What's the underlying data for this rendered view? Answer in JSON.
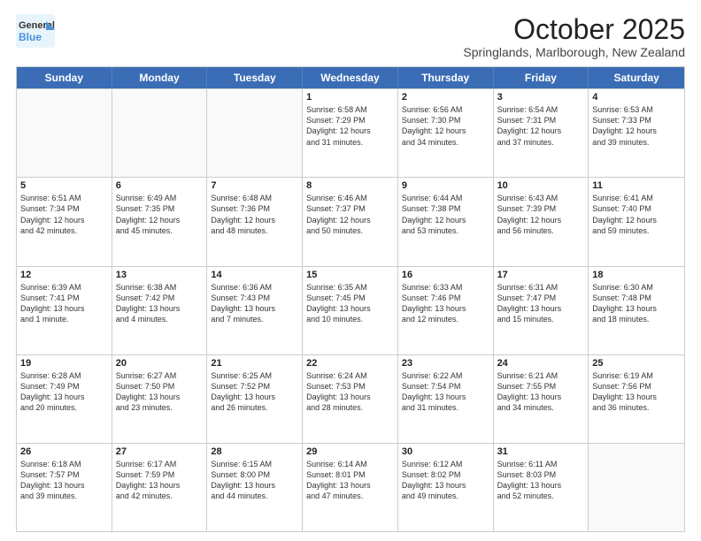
{
  "logo": {
    "line1": "General",
    "line2": "Blue"
  },
  "title": "October 2025",
  "subtitle": "Springlands, Marlborough, New Zealand",
  "header_days": [
    "Sunday",
    "Monday",
    "Tuesday",
    "Wednesday",
    "Thursday",
    "Friday",
    "Saturday"
  ],
  "rows": [
    [
      {
        "day": "",
        "text": ""
      },
      {
        "day": "",
        "text": ""
      },
      {
        "day": "",
        "text": ""
      },
      {
        "day": "1",
        "text": "Sunrise: 6:58 AM\nSunset: 7:29 PM\nDaylight: 12 hours\nand 31 minutes."
      },
      {
        "day": "2",
        "text": "Sunrise: 6:56 AM\nSunset: 7:30 PM\nDaylight: 12 hours\nand 34 minutes."
      },
      {
        "day": "3",
        "text": "Sunrise: 6:54 AM\nSunset: 7:31 PM\nDaylight: 12 hours\nand 37 minutes."
      },
      {
        "day": "4",
        "text": "Sunrise: 6:53 AM\nSunset: 7:33 PM\nDaylight: 12 hours\nand 39 minutes."
      }
    ],
    [
      {
        "day": "5",
        "text": "Sunrise: 6:51 AM\nSunset: 7:34 PM\nDaylight: 12 hours\nand 42 minutes."
      },
      {
        "day": "6",
        "text": "Sunrise: 6:49 AM\nSunset: 7:35 PM\nDaylight: 12 hours\nand 45 minutes."
      },
      {
        "day": "7",
        "text": "Sunrise: 6:48 AM\nSunset: 7:36 PM\nDaylight: 12 hours\nand 48 minutes."
      },
      {
        "day": "8",
        "text": "Sunrise: 6:46 AM\nSunset: 7:37 PM\nDaylight: 12 hours\nand 50 minutes."
      },
      {
        "day": "9",
        "text": "Sunrise: 6:44 AM\nSunset: 7:38 PM\nDaylight: 12 hours\nand 53 minutes."
      },
      {
        "day": "10",
        "text": "Sunrise: 6:43 AM\nSunset: 7:39 PM\nDaylight: 12 hours\nand 56 minutes."
      },
      {
        "day": "11",
        "text": "Sunrise: 6:41 AM\nSunset: 7:40 PM\nDaylight: 12 hours\nand 59 minutes."
      }
    ],
    [
      {
        "day": "12",
        "text": "Sunrise: 6:39 AM\nSunset: 7:41 PM\nDaylight: 13 hours\nand 1 minute."
      },
      {
        "day": "13",
        "text": "Sunrise: 6:38 AM\nSunset: 7:42 PM\nDaylight: 13 hours\nand 4 minutes."
      },
      {
        "day": "14",
        "text": "Sunrise: 6:36 AM\nSunset: 7:43 PM\nDaylight: 13 hours\nand 7 minutes."
      },
      {
        "day": "15",
        "text": "Sunrise: 6:35 AM\nSunset: 7:45 PM\nDaylight: 13 hours\nand 10 minutes."
      },
      {
        "day": "16",
        "text": "Sunrise: 6:33 AM\nSunset: 7:46 PM\nDaylight: 13 hours\nand 12 minutes."
      },
      {
        "day": "17",
        "text": "Sunrise: 6:31 AM\nSunset: 7:47 PM\nDaylight: 13 hours\nand 15 minutes."
      },
      {
        "day": "18",
        "text": "Sunrise: 6:30 AM\nSunset: 7:48 PM\nDaylight: 13 hours\nand 18 minutes."
      }
    ],
    [
      {
        "day": "19",
        "text": "Sunrise: 6:28 AM\nSunset: 7:49 PM\nDaylight: 13 hours\nand 20 minutes."
      },
      {
        "day": "20",
        "text": "Sunrise: 6:27 AM\nSunset: 7:50 PM\nDaylight: 13 hours\nand 23 minutes."
      },
      {
        "day": "21",
        "text": "Sunrise: 6:25 AM\nSunset: 7:52 PM\nDaylight: 13 hours\nand 26 minutes."
      },
      {
        "day": "22",
        "text": "Sunrise: 6:24 AM\nSunset: 7:53 PM\nDaylight: 13 hours\nand 28 minutes."
      },
      {
        "day": "23",
        "text": "Sunrise: 6:22 AM\nSunset: 7:54 PM\nDaylight: 13 hours\nand 31 minutes."
      },
      {
        "day": "24",
        "text": "Sunrise: 6:21 AM\nSunset: 7:55 PM\nDaylight: 13 hours\nand 34 minutes."
      },
      {
        "day": "25",
        "text": "Sunrise: 6:19 AM\nSunset: 7:56 PM\nDaylight: 13 hours\nand 36 minutes."
      }
    ],
    [
      {
        "day": "26",
        "text": "Sunrise: 6:18 AM\nSunset: 7:57 PM\nDaylight: 13 hours\nand 39 minutes."
      },
      {
        "day": "27",
        "text": "Sunrise: 6:17 AM\nSunset: 7:59 PM\nDaylight: 13 hours\nand 42 minutes."
      },
      {
        "day": "28",
        "text": "Sunrise: 6:15 AM\nSunset: 8:00 PM\nDaylight: 13 hours\nand 44 minutes."
      },
      {
        "day": "29",
        "text": "Sunrise: 6:14 AM\nSunset: 8:01 PM\nDaylight: 13 hours\nand 47 minutes."
      },
      {
        "day": "30",
        "text": "Sunrise: 6:12 AM\nSunset: 8:02 PM\nDaylight: 13 hours\nand 49 minutes."
      },
      {
        "day": "31",
        "text": "Sunrise: 6:11 AM\nSunset: 8:03 PM\nDaylight: 13 hours\nand 52 minutes."
      },
      {
        "day": "",
        "text": ""
      }
    ]
  ]
}
